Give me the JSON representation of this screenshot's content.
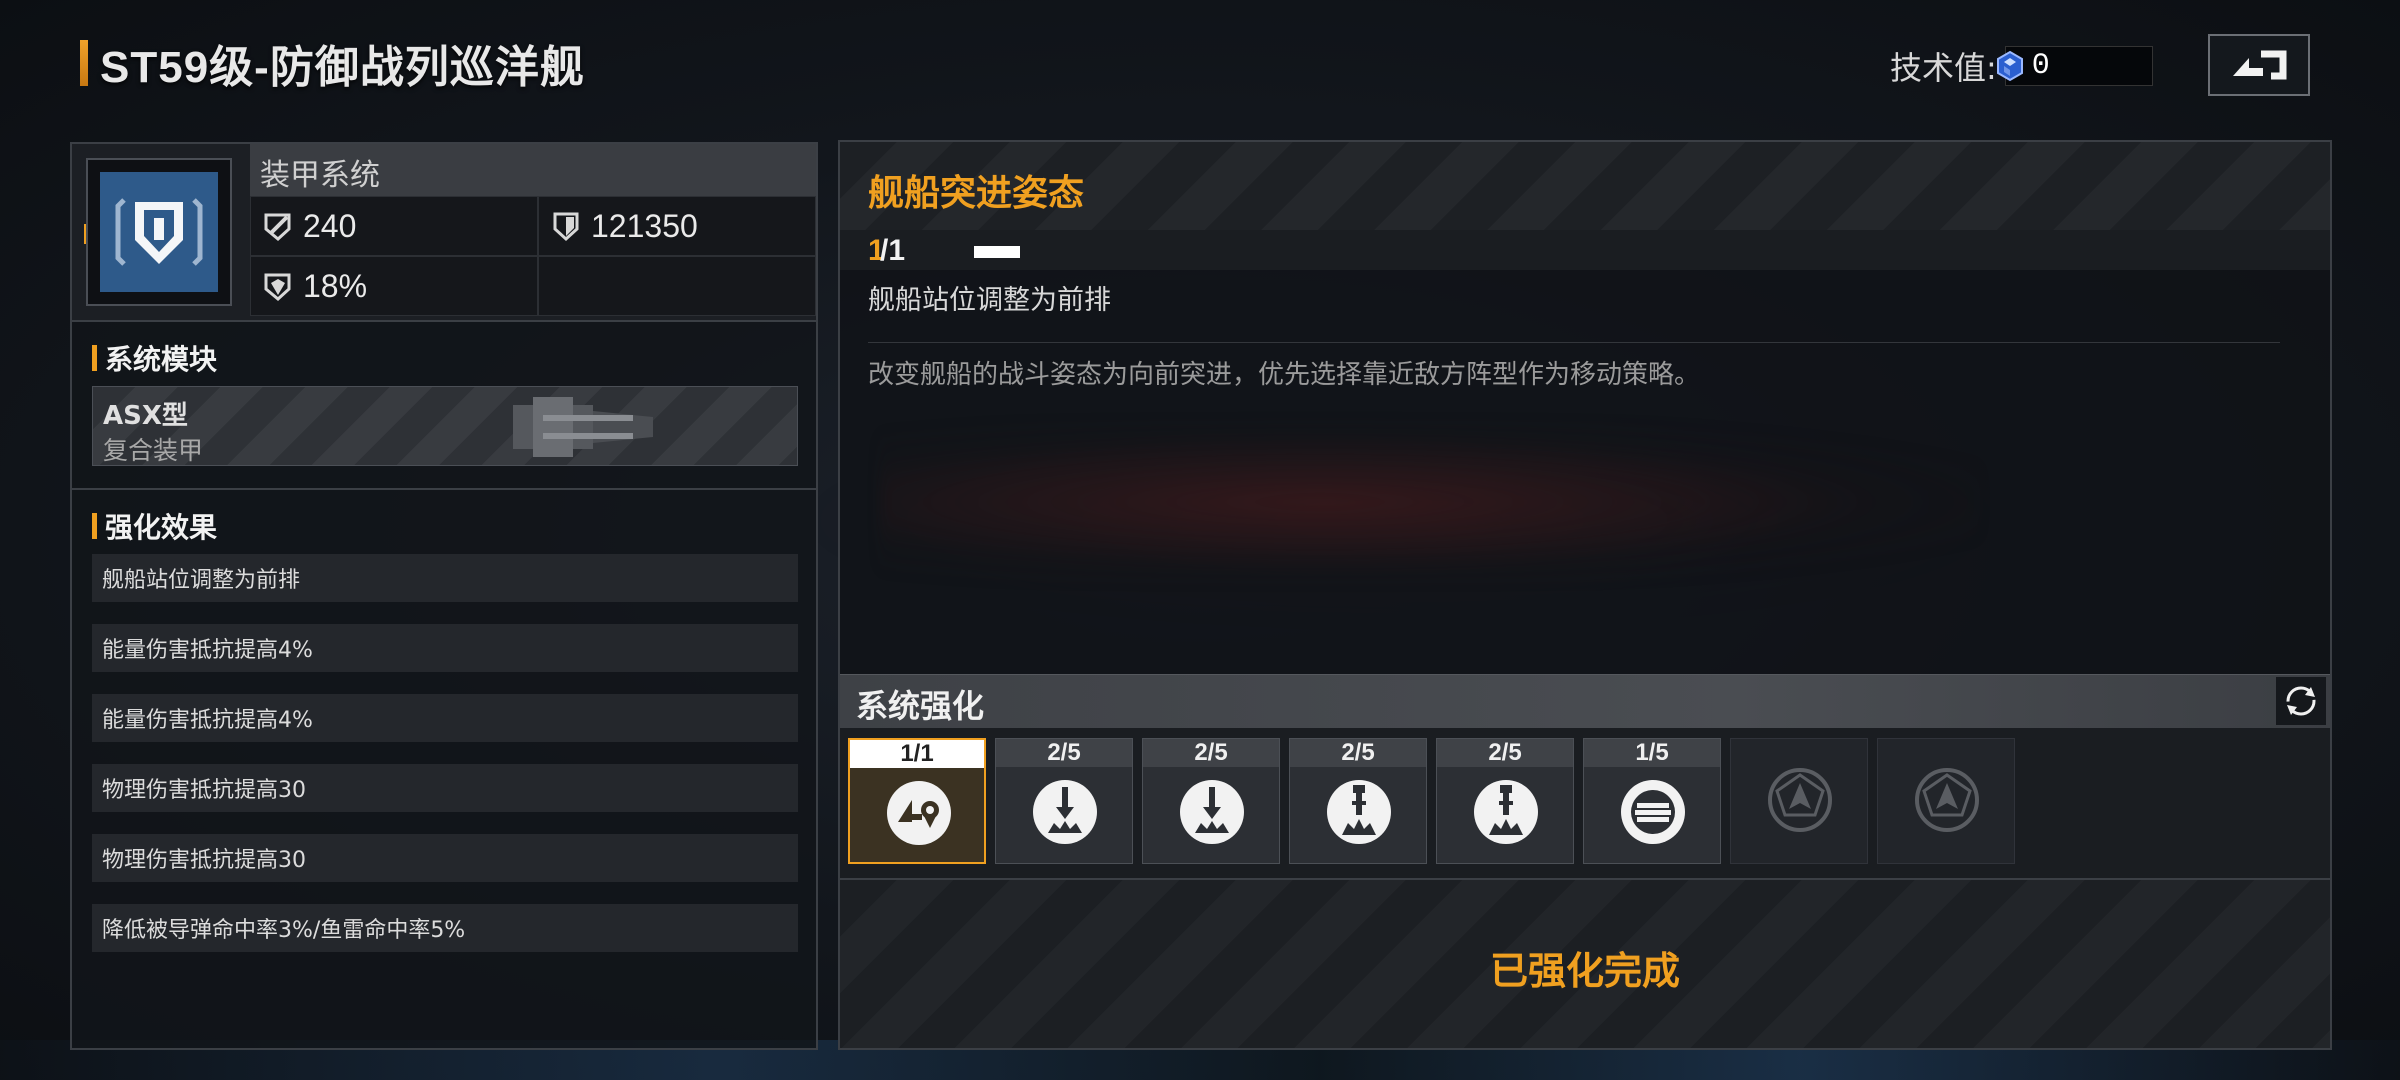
{
  "header": {
    "title": "ST59级-防御战列巡洋舰",
    "tech_label": "技术值:",
    "tech_value": "0"
  },
  "armor": {
    "title": "装甲系统",
    "stat_attack": "240",
    "stat_hp": "121350",
    "stat_resist": "18%"
  },
  "module": {
    "section_title": "系统模块",
    "name": "ASX型",
    "subtitle": "复合装甲"
  },
  "effects": {
    "section_title": "强化效果",
    "items": [
      "舰船站位调整为前排",
      "能量伤害抵抗提高4%",
      "能量伤害抵抗提高4%",
      "物理伤害抵抗提高30",
      "物理伤害抵抗提高30",
      "降低被导弹命中率3%/鱼雷命中率5%"
    ]
  },
  "skill": {
    "title": "舰船突进姿态",
    "level_current": "1",
    "level_max": "/1",
    "effect": "舰船站位调整为前排",
    "description": "改变舰船的战斗姿态为向前突进，优先选择靠近敌方阵型作为移动策略。"
  },
  "upgrade": {
    "title": "系统强化",
    "slots": [
      {
        "count": "1/1",
        "icon": "position-forward-icon"
      },
      {
        "count": "2/5",
        "icon": "energy-shield-icon"
      },
      {
        "count": "2/5",
        "icon": "energy-shield-icon"
      },
      {
        "count": "2/5",
        "icon": "physical-shield-icon"
      },
      {
        "count": "2/5",
        "icon": "physical-shield-icon"
      },
      {
        "count": "1/5",
        "icon": "missile-evade-icon"
      }
    ],
    "done_text": "已强化完成"
  },
  "colors": {
    "accent": "#f0a020",
    "armor_icon_bg": "#2e5a8a"
  }
}
